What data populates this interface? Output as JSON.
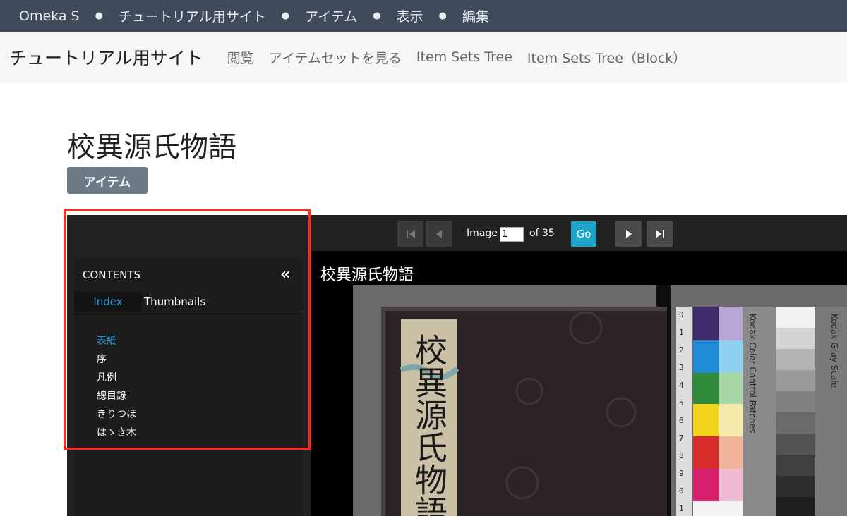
{
  "admin_bar": {
    "brand": "Omeka S",
    "crumbs": [
      "チュートリアル用サイト",
      "アイテム",
      "表示",
      "編集"
    ]
  },
  "site_nav": {
    "title": "チュートリアル用サイト",
    "links": [
      "閲覧",
      "アイテムセットを見る",
      "Item Sets Tree",
      "Item Sets Tree（Block）"
    ]
  },
  "page": {
    "title": "校異源氏物語",
    "badge": "アイテム"
  },
  "viewer": {
    "image_label": "Image",
    "current_page": "1",
    "of_label": "of 35",
    "go_label": "Go",
    "image_title": "校異源氏物語",
    "icons": [
      "first-page-icon",
      "prev-page-icon",
      "next-page-icon",
      "last-page-icon",
      "collapse-icon"
    ],
    "contents": {
      "header": "CONTENTS",
      "tabs": [
        "Index",
        "Thumbnails"
      ],
      "items": [
        "表紙",
        "序",
        "凡例",
        "總目錄",
        "きりつほ",
        "はゝき木"
      ]
    },
    "book_spine_text": "校異源氏物語",
    "kodak_text": [
      "Kodak Color Control Patches",
      "Kodak Gray Scale"
    ],
    "colors": {
      "link_active": "#2a9fd6",
      "go_button": "#1ea5c9",
      "highlight": "#ff2a1a"
    }
  }
}
